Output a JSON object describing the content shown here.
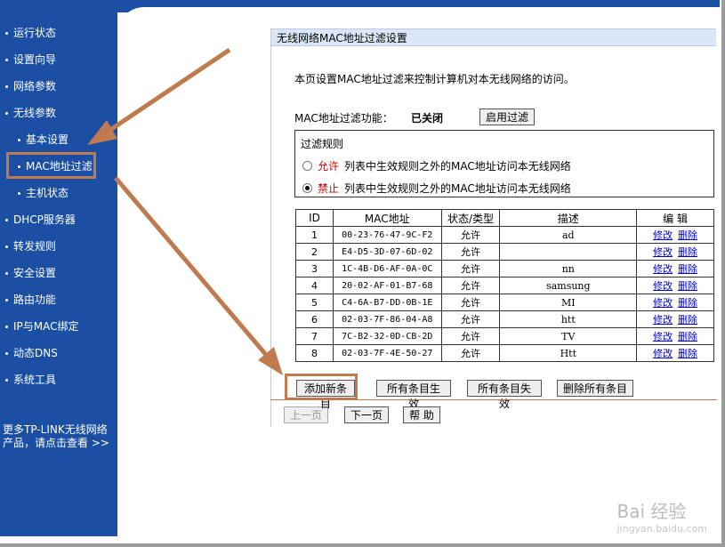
{
  "sidebar": {
    "items": [
      {
        "label": "运行状态",
        "sub": false
      },
      {
        "label": "设置向导",
        "sub": false
      },
      {
        "label": "网络参数",
        "sub": false
      },
      {
        "label": "无线参数",
        "sub": false
      },
      {
        "label": "基本设置",
        "sub": true
      },
      {
        "label": "MAC地址过滤",
        "sub": true
      },
      {
        "label": "主机状态",
        "sub": true
      },
      {
        "label": "DHCP服务器",
        "sub": false
      },
      {
        "label": "转发规则",
        "sub": false
      },
      {
        "label": "安全设置",
        "sub": false
      },
      {
        "label": "路由功能",
        "sub": false
      },
      {
        "label": "IP与MAC绑定",
        "sub": false
      },
      {
        "label": "动态DNS",
        "sub": false
      },
      {
        "label": "系统工具",
        "sub": false
      }
    ],
    "more_line1": "更多TP-LINK无线网络",
    "more_line2": "产品，请点击查看 >>"
  },
  "panel": {
    "title": "无线网络MAC地址过滤设置",
    "intro": "本页设置MAC地址过滤来控制计算机对本无线网络的访问。",
    "func_label": "MAC地址过滤功能：",
    "func_status": "已关闭",
    "enable_button": "启用过滤",
    "rules_title": "过滤规则",
    "allow_keyword": "允许",
    "allow_text": "列表中生效规则之外的MAC地址访问本无线网络",
    "deny_keyword": "禁止",
    "deny_text": "列表中生效规则之外的MAC地址访问本无线网络"
  },
  "table": {
    "headers": [
      "ID",
      "MAC地址",
      "状态/类型",
      "描述",
      "编 辑"
    ],
    "edit_label": "修改",
    "delete_label": "删除",
    "rows": [
      {
        "id": "1",
        "mac": "00-23-76-47-9C-F2",
        "status": "允许",
        "desc": "ad"
      },
      {
        "id": "2",
        "mac": "E4-D5-3D-07-6D-02",
        "status": "允许",
        "desc": ""
      },
      {
        "id": "3",
        "mac": "1C-4B-D6-AF-0A-0C",
        "status": "允许",
        "desc": "nn"
      },
      {
        "id": "4",
        "mac": "20-02-AF-01-B7-68",
        "status": "允许",
        "desc": "samsung"
      },
      {
        "id": "5",
        "mac": "C4-6A-B7-DD-0B-1E",
        "status": "允许",
        "desc": "MI"
      },
      {
        "id": "6",
        "mac": "02-03-7F-86-04-A8",
        "status": "允许",
        "desc": "htt"
      },
      {
        "id": "7",
        "mac": "7C-B2-32-0D-CB-2D",
        "status": "允许",
        "desc": "TV"
      },
      {
        "id": "8",
        "mac": "02-03-7F-4E-50-27",
        "status": "允许",
        "desc": "Htt"
      }
    ]
  },
  "actions": {
    "add": "添加新条目",
    "enable_all": "所有条目生效",
    "disable_all": "所有条目失效",
    "delete_all": "删除所有条目"
  },
  "nav": {
    "prev": "上一页",
    "next": "下一页",
    "help": "帮 助"
  },
  "watermark": {
    "brand": "Bai 经验",
    "url": "jingyan.baidu.com"
  },
  "colors": {
    "sidebar_bg": "#1a4fa3",
    "annotation": "#c07a4f",
    "title_bar": "#dbe7f7",
    "link": "#0000cc",
    "red": "#d40000"
  }
}
